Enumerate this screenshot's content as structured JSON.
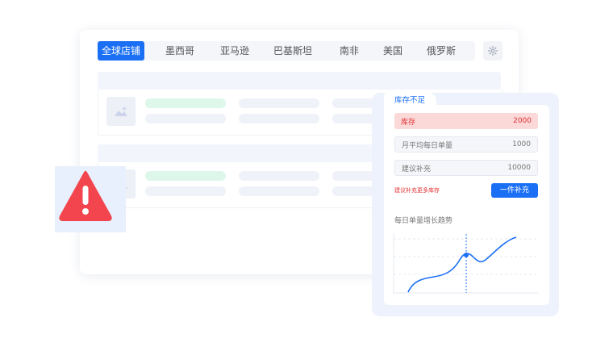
{
  "tabs": [
    {
      "label": "全球店铺",
      "active": true
    },
    {
      "label": "墨西哥",
      "active": false
    },
    {
      "label": "亚马逊",
      "active": false
    },
    {
      "label": "巴基斯坦",
      "active": false
    },
    {
      "label": "南非",
      "active": false
    },
    {
      "label": "美国",
      "active": false
    },
    {
      "label": "俄罗斯",
      "active": false
    }
  ],
  "icons": {
    "settings": "gear-icon",
    "alert": "warning-icon",
    "thumbnail": "image-placeholder-icon"
  },
  "panel": {
    "tab_label": "库存不足",
    "stock": {
      "label": "库存",
      "value": "2000"
    },
    "monthly_avg": {
      "label": "月平均每日单量",
      "value": "1000"
    },
    "suggested": {
      "label": "建议补充",
      "value": "10000"
    },
    "hint": "建议补充更多库存",
    "action_button": "一件补充",
    "chart_title": "每日单量增长趋势"
  },
  "colors": {
    "accent": "#1b6ff5",
    "danger": "#e03131",
    "alert_red": "#f2454d",
    "success_bg": "#ddf7ea"
  }
}
